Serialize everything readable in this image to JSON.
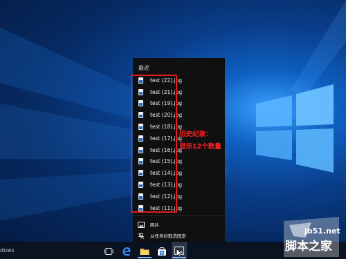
{
  "jump_list": {
    "heading": "最近",
    "recent_files": [
      "test (22).jpg",
      "test (21).jpg",
      "test (19).jpg",
      "test (20).jpg",
      "test (18).jpg",
      "test (17).jpg",
      "test (16).jpg",
      "test (15).jpg",
      "test (14).jpg",
      "test (13).jpg",
      "test (12).jpg",
      "test (11).jpg"
    ],
    "actions": {
      "photos_label": "照片",
      "unpin_label": "从任务栏取消固定"
    }
  },
  "annotation": {
    "line1": "历史纪录：",
    "line2": "显示12个数量",
    "color": "#e21b1b"
  },
  "taskbar": {
    "search_text_partial": "dows",
    "icons": [
      "task-view-icon",
      "edge-icon",
      "file-explorer-icon",
      "store-icon",
      "photos-icon"
    ],
    "accent": "#7fb2ff"
  },
  "watermark": {
    "url": "jb51.net",
    "text": "脚本之家"
  }
}
